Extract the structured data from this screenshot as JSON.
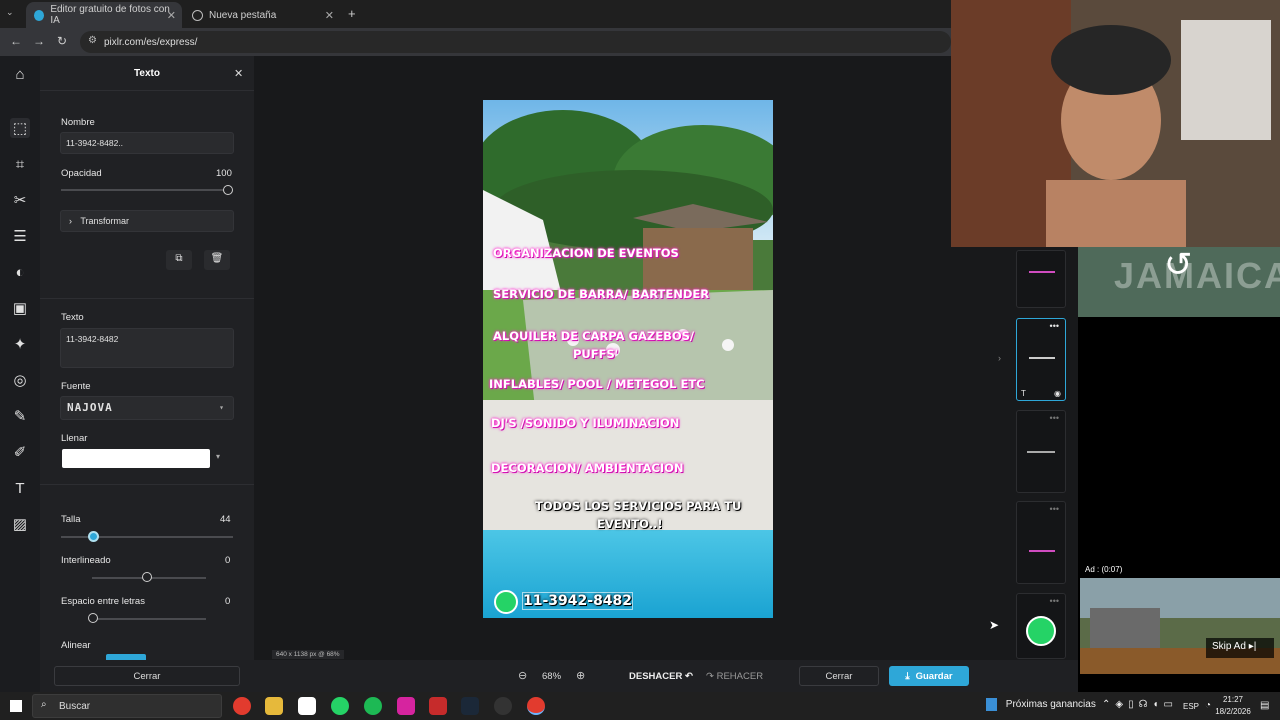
{
  "browser": {
    "tabs": [
      {
        "title": "Editor gratuito de fotos con IA",
        "active": true
      },
      {
        "title": "Nueva pestaña",
        "active": false
      }
    ],
    "new_tab": "+",
    "url": "pixlr.com/es/express/"
  },
  "panel": {
    "title": "Texto",
    "close": "✕",
    "name_label": "Nombre",
    "name_value": "11-3942-8482..",
    "opacity_label": "Opacidad",
    "opacity_value": "100",
    "transform_label": "Transformar",
    "text_label": "Texto",
    "text_value": "11-3942-8482",
    "font_label": "Fuente",
    "font_value": "NAJOVA",
    "fill_label": "Llenar",
    "fill_color": "#ffffff",
    "size_label": "Talla",
    "size_value": "44",
    "line_height_label": "Interlineado",
    "line_height_value": "0",
    "letter_spacing_label": "Espacio entre letras",
    "letter_spacing_value": "0",
    "align_label": "Alinear",
    "close_button": "Cerrar"
  },
  "poster": {
    "lines": [
      "ORGANIZACION DE EVENTOS",
      "SERVICIO DE BARRA/ BARTENDER",
      "ALQUILER DE CARPA GAZEBOS/",
      "PUFFS'",
      "INFLABLES/ POOL / METEGOL ETC",
      "DJ'S /SONIDO Y ILUMINACION",
      "DECORACION/ AMBIENTACION"
    ],
    "cta_1": "TODOS LOS SERVICIOS PARA TU",
    "cta_2": "EVENTO..!",
    "phone": "11-3942-8482"
  },
  "canvas_info": "640 x 1138 px @ 68%",
  "bottom": {
    "zoom": "68%",
    "undo": "DESHACER",
    "redo": "REHACER",
    "close": "Cerrar",
    "save": "Guardar"
  },
  "overlay": {
    "ad_label": "Ad : (0:07)",
    "skip": "Skip Ad ▸|",
    "stream_logo": "JAMAICA"
  },
  "taskbar": {
    "search": "Buscar",
    "earnings": "Próximas ganancias",
    "lang": "ESP",
    "time": "21:27",
    "date": "18/2/2026"
  },
  "accent": "#2ea7d8"
}
